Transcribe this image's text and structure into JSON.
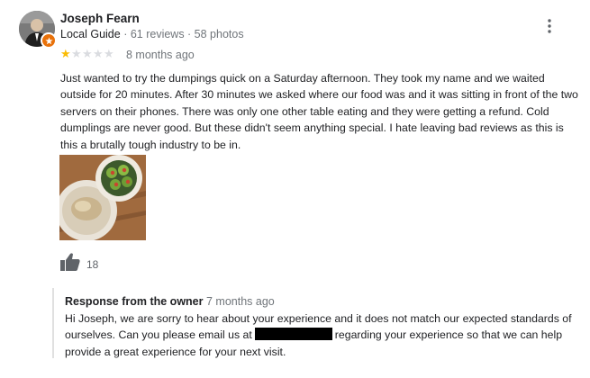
{
  "review": {
    "author_name": "Joseph Fearn",
    "author_level": "Local Guide",
    "author_stats": "61 reviews · 58 photos",
    "rating": 1,
    "max_rating": 5,
    "time_ago": "8 months ago",
    "text": "Just wanted to try the dumpings quick on a Saturday afternoon. They took my name and we waited outside for 20 minutes. After 30 minutes we asked where our food was and it was sitting in front of the two servers on their phones. There was only one other table eating and they were getting a refund. Cold dumplings are never good. But these didn't seem anything special. I hate leaving bad reviews as this is this a brutally tough industry to be in.",
    "likes": "18"
  },
  "owner_response": {
    "label": "Response from the owner",
    "time_ago": "7 months ago",
    "text_before": "Hi Joseph, we are sorry to hear about your experience and it does not match our expected standards of ourselves. Can you please email us at",
    "text_after": "regarding your experience so that we can help provide a great experience for your next visit."
  },
  "colors": {
    "star_filled": "#fbbc04",
    "star_empty": "#dadce0",
    "badge": "#e8710a",
    "secondary_text": "#70757a"
  },
  "icons": {
    "more": "more-vert-icon",
    "like": "thumb-up-icon",
    "badge": "local-guide-star-icon"
  }
}
